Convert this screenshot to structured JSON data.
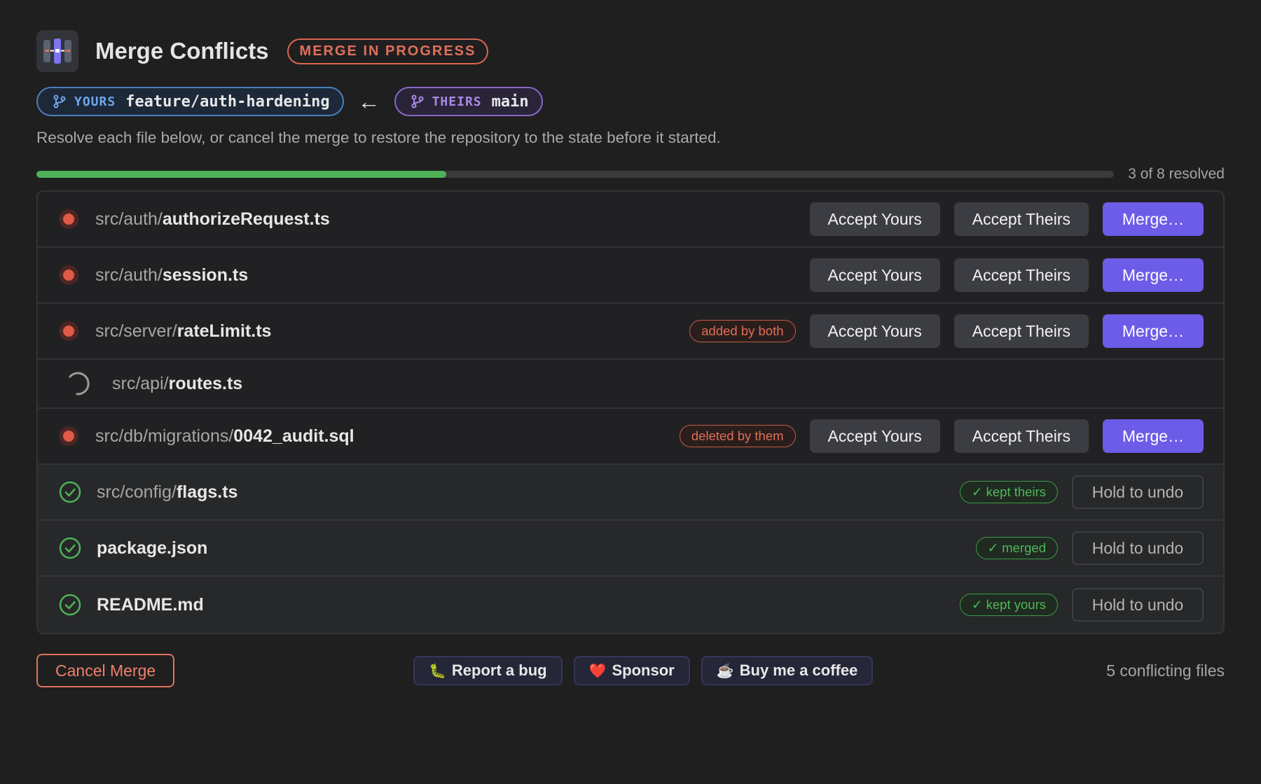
{
  "header": {
    "title": "Merge Conflicts",
    "status": "MERGE IN PROGRESS",
    "icon": "merge-app-icon"
  },
  "branches": {
    "yours_tag": "YOURS",
    "yours_name": "feature/auth-hardening",
    "arrow": "←",
    "theirs_tag": "THEIRS",
    "theirs_name": "main"
  },
  "subtitle": "Resolve each file below, or cancel the merge to restore the repository to the state before it started.",
  "progress": {
    "text": "3 of 8 resolved",
    "resolved": 3,
    "total": 8,
    "fraction": 0.38
  },
  "files": [
    {
      "dir": "src/auth/",
      "name": "authorizeRequest.ts",
      "state": "conflict",
      "badge": "",
      "accept_yours": "Accept Yours",
      "accept_theirs": "Accept Theirs",
      "merge": "Merge…"
    },
    {
      "dir": "src/auth/",
      "name": "session.ts",
      "state": "conflict",
      "badge": "",
      "accept_yours": "Accept Yours",
      "accept_theirs": "Accept Theirs",
      "merge": "Merge…"
    },
    {
      "dir": "src/server/",
      "name": "rateLimit.ts",
      "state": "conflict",
      "badge": "added by both",
      "accept_yours": "Accept Yours",
      "accept_theirs": "Accept Theirs",
      "merge": "Merge…"
    },
    {
      "dir": "src/api/",
      "name": "routes.ts",
      "state": "pending"
    },
    {
      "dir": "src/db/migrations/",
      "name": "0042_audit.sql",
      "state": "conflict",
      "badge": "deleted by them",
      "accept_yours": "Accept Yours",
      "accept_theirs": "Accept Theirs",
      "merge": "Merge…"
    },
    {
      "dir": "src/config/",
      "name": "flags.ts",
      "state": "resolved",
      "badge": "✓ kept theirs",
      "undo": "Hold to undo"
    },
    {
      "dir": "",
      "name": "package.json",
      "state": "resolved",
      "badge": "✓ merged",
      "undo": "Hold to undo"
    },
    {
      "dir": "",
      "name": "README.md",
      "state": "resolved",
      "badge": "✓ kept yours",
      "undo": "Hold to undo"
    }
  ],
  "footer": {
    "cancel": "Cancel Merge",
    "report_bug": "Report a bug",
    "report_bug_emoji": "🐛",
    "sponsor": "Sponsor",
    "sponsor_emoji": "❤️",
    "coffee": "Buy me a coffee",
    "coffee_emoji": "☕",
    "conflict_count": "5 conflicting files"
  },
  "colors": {
    "accent": "#6c5ce7",
    "conflict": "#e05a46",
    "resolved": "#4fb258",
    "yours": "#6ea6ec",
    "theirs": "#a98ae6"
  }
}
